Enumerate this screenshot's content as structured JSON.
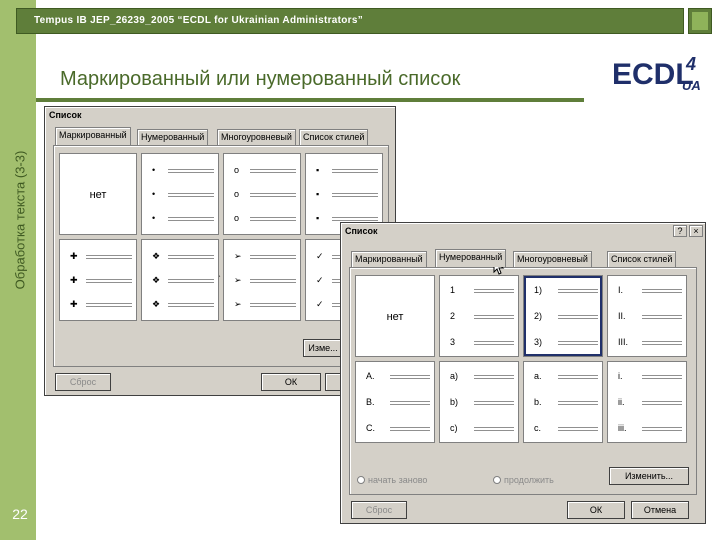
{
  "slide": {
    "header": "Tempus IB JEP_26239_2005 “ECDL for Ukrainian Administrators”",
    "title": "Маркированный или нумерованный список",
    "side_title": "Обработка текста (3-3)",
    "page_number": "22",
    "logo": {
      "main": "ECDL",
      "number": "4",
      "suffix": "UA"
    }
  },
  "colors": {
    "strip": "#a2bf6e",
    "header": "#5f7e3a",
    "title": "#4a6a2a",
    "dialog": "#d4d0c8",
    "selection": "#20306a"
  },
  "dialog_back": {
    "title": "Список",
    "tabs": [
      "Маркированный",
      "Нумерованный",
      "Многоуровневый",
      "Список стилей"
    ],
    "active_tab": 0,
    "none_label": "нет",
    "cells": [
      {
        "markers": []
      },
      {
        "markers": [
          "•",
          "•",
          "•"
        ]
      },
      {
        "markers": [
          "o",
          "o",
          "o"
        ]
      },
      {
        "markers": [
          "▪",
          "▪",
          "▪"
        ]
      },
      {
        "markers": [
          "✚",
          "✚",
          "✚"
        ]
      },
      {
        "markers": [
          "❖",
          "❖",
          "❖"
        ]
      },
      {
        "markers": [
          "➢",
          "➢",
          "➢"
        ]
      },
      {
        "markers": [
          "✓",
          "✓",
          "✓"
        ]
      }
    ],
    "change_button": "Изме...",
    "reset_button": "Сброс",
    "ok_button": "ОК"
  },
  "dialog_front": {
    "title": "Список",
    "close_glyph": "×",
    "help_glyph": "?",
    "tabs": [
      "Маркированный",
      "Нумерованный",
      "Многоуровневый",
      "Список стилей"
    ],
    "active_tab": 1,
    "none_label": "нет",
    "cells": [
      {
        "markers": []
      },
      {
        "markers": [
          "1",
          "2",
          "3"
        ]
      },
      {
        "markers": [
          "1)",
          "2)",
          "3)"
        ]
      },
      {
        "markers": [
          "I.",
          "II.",
          "III."
        ]
      },
      {
        "markers": [
          "A.",
          "B.",
          "C."
        ]
      },
      {
        "markers": [
          "a)",
          "b)",
          "c)"
        ]
      },
      {
        "markers": [
          "a.",
          "b.",
          "c."
        ]
      },
      {
        "markers": [
          "i.",
          "ii.",
          "iii."
        ]
      }
    ],
    "selected_cell": 2,
    "radio_restart": "начать заново",
    "radio_continue": "продолжить",
    "change_button": "Изменить...",
    "reset_button": "Сброс",
    "ok_button": "ОК",
    "cancel_button": "Отмена"
  }
}
